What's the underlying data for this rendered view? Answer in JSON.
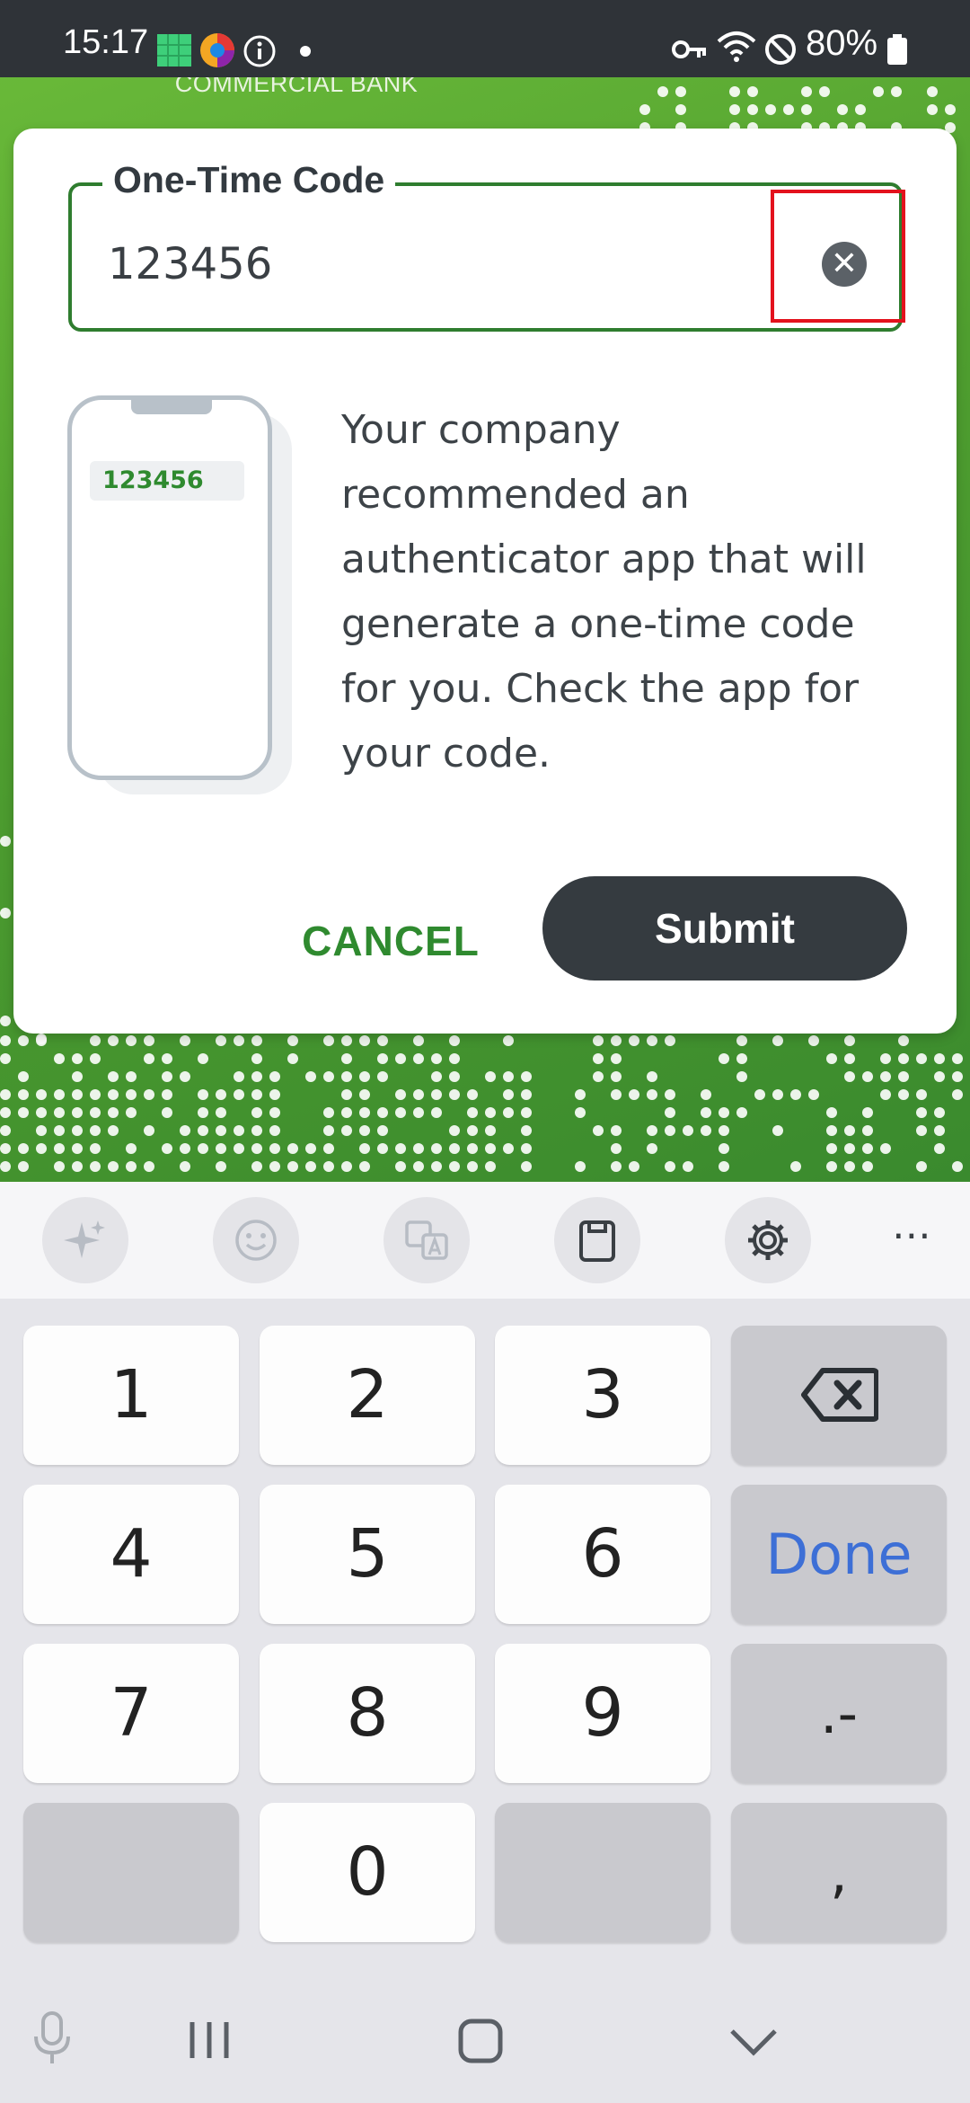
{
  "status_bar": {
    "time": "15:17",
    "battery": "80%"
  },
  "app": {
    "brand_text": "COMMERCIAL BANK",
    "accent_color": "#2f8a2f"
  },
  "dialog": {
    "field_label": "One-Time Code",
    "field_value": "123456",
    "illustration_code": "123456",
    "message": "Your company recommended an authenticator app that will generate a one-time code for you. Check the app for your code.",
    "cancel_label": "CANCEL",
    "submit_label": "Submit"
  },
  "keyboard": {
    "keys": [
      "1",
      "2",
      "3",
      "4",
      "5",
      "6",
      "7",
      "8",
      "9",
      "0"
    ],
    "done_label": "Done",
    "punct_label": ".-",
    "comma_label": ",",
    "more_label": "⋯"
  }
}
